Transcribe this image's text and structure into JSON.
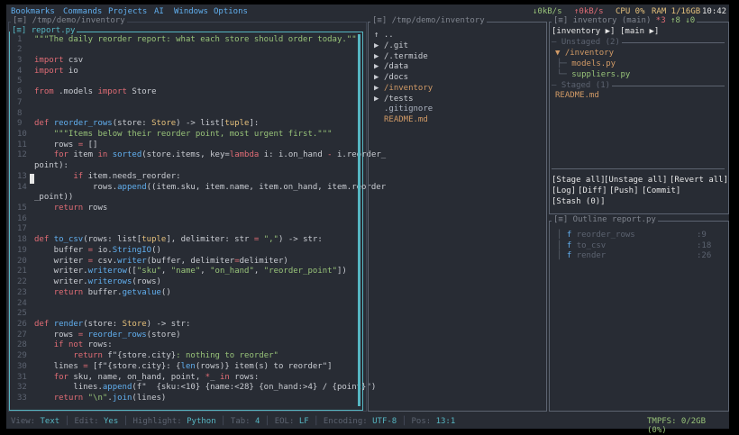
{
  "menubar": {
    "items": [
      "Bookmarks",
      "Commands",
      "Projects",
      "AI",
      "Windows",
      "Options"
    ],
    "net_down": "↓0kB/s",
    "net_up": "↑0kB/s",
    "cpu": "CPU 0%",
    "ram": "RAM 1/16GB",
    "clock": "10:42"
  },
  "colors": {
    "accent": "#56b6c2",
    "keyword": "#e06c75",
    "function": "#61afef",
    "string": "#98c379",
    "type": "#e5c07b",
    "orange": "#d19a66",
    "bg": "#282c34"
  },
  "editor": {
    "path_title": "[≡] /tmp/demo/inventory",
    "file_tag": "[≡]",
    "file_name": "report.py",
    "cursor_line": "13",
    "lines": [
      {
        "n": "1",
        "segs": [
          [
            "st",
            "\"\"\"The daily reorder report: what each store should order today.\"\"\""
          ]
        ]
      },
      {
        "n": "2",
        "segs": []
      },
      {
        "n": "3",
        "segs": [
          [
            "kw",
            "import"
          ],
          [
            "pl",
            " csv"
          ]
        ]
      },
      {
        "n": "4",
        "segs": [
          [
            "kw",
            "import"
          ],
          [
            "pl",
            " io"
          ]
        ]
      },
      {
        "n": "5",
        "segs": []
      },
      {
        "n": "6",
        "segs": [
          [
            "kw",
            "from"
          ],
          [
            "pl",
            " .models "
          ],
          [
            "kw",
            "import"
          ],
          [
            "pl",
            " Store"
          ]
        ]
      },
      {
        "n": "7",
        "segs": []
      },
      {
        "n": "8",
        "segs": []
      },
      {
        "n": "9",
        "segs": [
          [
            "kw",
            "def"
          ],
          [
            "pl",
            " "
          ],
          [
            "fn",
            "reorder_rows"
          ],
          [
            "pl",
            "(store: "
          ],
          [
            "ty",
            "Store"
          ],
          [
            "pl",
            ") -> list["
          ],
          [
            "ty",
            "tuple"
          ],
          [
            "pl",
            "]:"
          ]
        ]
      },
      {
        "n": "10",
        "segs": [
          [
            "pl",
            "    "
          ],
          [
            "st",
            "\"\"\"Items below their reorder point, most urgent first.\"\"\""
          ]
        ]
      },
      {
        "n": "11",
        "segs": [
          [
            "pl",
            "    rows "
          ],
          [
            "kw",
            "="
          ],
          [
            "pl",
            " []"
          ]
        ]
      },
      {
        "n": "12",
        "segs": [
          [
            "pl",
            "    "
          ],
          [
            "kw",
            "for"
          ],
          [
            "pl",
            " item "
          ],
          [
            "kw",
            "in"
          ],
          [
            "pl",
            " "
          ],
          [
            "fn",
            "sorted"
          ],
          [
            "pl",
            "(store.items, key="
          ],
          [
            "kw",
            "lambda"
          ],
          [
            "pl",
            " i: i.on_hand "
          ],
          [
            "kw",
            "-"
          ],
          [
            "pl",
            " i.reorder_"
          ]
        ]
      },
      {
        "n": "",
        "segs": [
          [
            "pl",
            "point):"
          ]
        ]
      },
      {
        "n": "13",
        "segs": [
          [
            "pl",
            "        "
          ],
          [
            "kw",
            "if"
          ],
          [
            "pl",
            " item.needs_reorder:"
          ]
        ]
      },
      {
        "n": "14",
        "segs": [
          [
            "pl",
            "            rows."
          ],
          [
            "fn",
            "append"
          ],
          [
            "pl",
            "((item.sku, item.name, item.on_hand, item.reorder"
          ]
        ]
      },
      {
        "n": "",
        "segs": [
          [
            "pl",
            "_point))"
          ]
        ]
      },
      {
        "n": "15",
        "segs": [
          [
            "pl",
            "    "
          ],
          [
            "kw",
            "return"
          ],
          [
            "pl",
            " rows"
          ]
        ]
      },
      {
        "n": "16",
        "segs": []
      },
      {
        "n": "17",
        "segs": []
      },
      {
        "n": "18",
        "segs": [
          [
            "kw",
            "def"
          ],
          [
            "pl",
            " "
          ],
          [
            "fn",
            "to_csv"
          ],
          [
            "pl",
            "(rows: list["
          ],
          [
            "ty",
            "tuple"
          ],
          [
            "pl",
            "], delimiter: str "
          ],
          [
            "kw",
            "="
          ],
          [
            "pl",
            " "
          ],
          [
            "st",
            "\",\""
          ],
          [
            "pl",
            ") -> str:"
          ]
        ]
      },
      {
        "n": "19",
        "segs": [
          [
            "pl",
            "    buffer "
          ],
          [
            "kw",
            "="
          ],
          [
            "pl",
            " io."
          ],
          [
            "fn",
            "StringIO"
          ],
          [
            "pl",
            "()"
          ]
        ]
      },
      {
        "n": "20",
        "segs": [
          [
            "pl",
            "    writer "
          ],
          [
            "kw",
            "="
          ],
          [
            "pl",
            " csv."
          ],
          [
            "fn",
            "writer"
          ],
          [
            "pl",
            "(buffer, delimiter"
          ],
          [
            "kw",
            "="
          ],
          [
            "pl",
            "delimiter)"
          ]
        ]
      },
      {
        "n": "21",
        "segs": [
          [
            "pl",
            "    writer."
          ],
          [
            "fn",
            "writerow"
          ],
          [
            "pl",
            "(["
          ],
          [
            "st",
            "\"sku\""
          ],
          [
            "pl",
            ", "
          ],
          [
            "st",
            "\"name\""
          ],
          [
            "pl",
            ", "
          ],
          [
            "st",
            "\"on_hand\""
          ],
          [
            "pl",
            ", "
          ],
          [
            "st",
            "\"reorder_point\""
          ],
          [
            "pl",
            "])"
          ]
        ]
      },
      {
        "n": "22",
        "segs": [
          [
            "pl",
            "    writer."
          ],
          [
            "fn",
            "writerows"
          ],
          [
            "pl",
            "(rows)"
          ]
        ]
      },
      {
        "n": "23",
        "segs": [
          [
            "pl",
            "    "
          ],
          [
            "kw",
            "return"
          ],
          [
            "pl",
            " buffer."
          ],
          [
            "fn",
            "getvalue"
          ],
          [
            "pl",
            "()"
          ]
        ]
      },
      {
        "n": "24",
        "segs": []
      },
      {
        "n": "25",
        "segs": []
      },
      {
        "n": "26",
        "segs": [
          [
            "kw",
            "def"
          ],
          [
            "pl",
            " "
          ],
          [
            "fn",
            "render"
          ],
          [
            "pl",
            "(store: "
          ],
          [
            "ty",
            "Store"
          ],
          [
            "pl",
            ") -> str:"
          ]
        ]
      },
      {
        "n": "27",
        "segs": [
          [
            "pl",
            "    rows "
          ],
          [
            "kw",
            "="
          ],
          [
            "pl",
            " "
          ],
          [
            "fn",
            "reorder_rows"
          ],
          [
            "pl",
            "(store)"
          ]
        ]
      },
      {
        "n": "28",
        "segs": [
          [
            "pl",
            "    "
          ],
          [
            "kw",
            "if not"
          ],
          [
            "pl",
            " rows:"
          ]
        ]
      },
      {
        "n": "29",
        "segs": [
          [
            "pl",
            "        "
          ],
          [
            "kw",
            "return"
          ],
          [
            "pl",
            " f\""
          ],
          [
            "pl",
            "{store.city}"
          ],
          [
            "st",
            ": nothing to reorder\""
          ]
        ]
      },
      {
        "n": "30",
        "segs": [
          [
            "pl",
            "    lines "
          ],
          [
            "kw",
            "="
          ],
          [
            "pl",
            " [f\"{store.city}: {"
          ],
          [
            "fn",
            "len"
          ],
          [
            "pl",
            "(rows)} item(s) to reorder\"]"
          ]
        ]
      },
      {
        "n": "31",
        "segs": [
          [
            "pl",
            "    "
          ],
          [
            "kw",
            "for"
          ],
          [
            "pl",
            " sku, name, on_hand, point, "
          ],
          [
            "kw",
            "*"
          ],
          [
            "pl",
            "_ "
          ],
          [
            "kw",
            "in"
          ],
          [
            "pl",
            " rows:"
          ]
        ]
      },
      {
        "n": "32",
        "segs": [
          [
            "pl",
            "        lines."
          ],
          [
            "fn",
            "append"
          ],
          [
            "pl",
            "(f\"  {sku:<10} {name:<28} {on_hand:>4} / {point}\")"
          ]
        ]
      },
      {
        "n": "33",
        "segs": [
          [
            "pl",
            "    "
          ],
          [
            "kw",
            "return"
          ],
          [
            "pl",
            " "
          ],
          [
            "st",
            "\"\\n\""
          ],
          [
            "pl",
            "."
          ],
          [
            "fn",
            "join"
          ],
          [
            "pl",
            "(lines)"
          ]
        ]
      }
    ]
  },
  "explorer": {
    "title": "[≡] /tmp/demo/inventory",
    "up": "↑ ..",
    "items": [
      {
        "arrow": "▶",
        "name": "/.git",
        "color": "#c9ccd2"
      },
      {
        "arrow": "▶",
        "name": "/.termide",
        "color": "#c9ccd2"
      },
      {
        "arrow": "▶",
        "name": "/data",
        "color": "#c9ccd2"
      },
      {
        "arrow": "▶",
        "name": "/docs",
        "color": "#c9ccd2"
      },
      {
        "arrow": "▶",
        "name": "/inventory",
        "color": "#d19a66"
      },
      {
        "arrow": "▶",
        "name": "/tests",
        "color": "#c9ccd2"
      },
      {
        "arrow": "",
        "name": ".gitignore",
        "color": "#abb2bf"
      },
      {
        "arrow": "",
        "name": "README.md",
        "color": "#d19a66"
      }
    ]
  },
  "git": {
    "title": "[≡] inventory (main)",
    "ahead": "*3",
    "up": "↑8",
    "down": "↓0",
    "repo_btn": "[inventory ▶]",
    "branch_btn": "[main ▶]",
    "unstaged_label": "Unstaged (2)",
    "unstaged_folder": "▼ /inventory",
    "unstaged_files": [
      {
        "prefix": "├─",
        "name": "models.py"
      },
      {
        "prefix": "└─",
        "name": "suppliers.py"
      }
    ],
    "staged_label": "Staged (1)",
    "staged_files": [
      "README.md"
    ],
    "actions_row1": [
      "[Stage all]",
      "[Unstage all]",
      "[Revert all]"
    ],
    "actions_row2": [
      "[Log]",
      "[Diff]",
      "[Push]",
      "[Commit]"
    ],
    "actions_row3": [
      "[Stash (0)]"
    ]
  },
  "outline": {
    "title": "[≡] Outline report.py",
    "items": [
      {
        "kind": "f",
        "name": "reorder_rows",
        "line": ":9"
      },
      {
        "kind": "f",
        "name": "to_csv",
        "line": ":18"
      },
      {
        "kind": "f",
        "name": "render",
        "line": ":26"
      }
    ]
  },
  "statusbar": {
    "fields": [
      {
        "k": "View:",
        "v": "Text"
      },
      {
        "k": "Edit:",
        "v": "Yes"
      },
      {
        "k": "Highlight:",
        "v": "Python"
      },
      {
        "k": "Tab:",
        "v": "4"
      },
      {
        "k": "EOL:",
        "v": "LF"
      },
      {
        "k": "Encoding:",
        "v": "UTF-8"
      },
      {
        "k": "Pos:",
        "v": "13:1"
      }
    ],
    "tmpfs": "TMPFS: 0/2GB (0%)"
  }
}
